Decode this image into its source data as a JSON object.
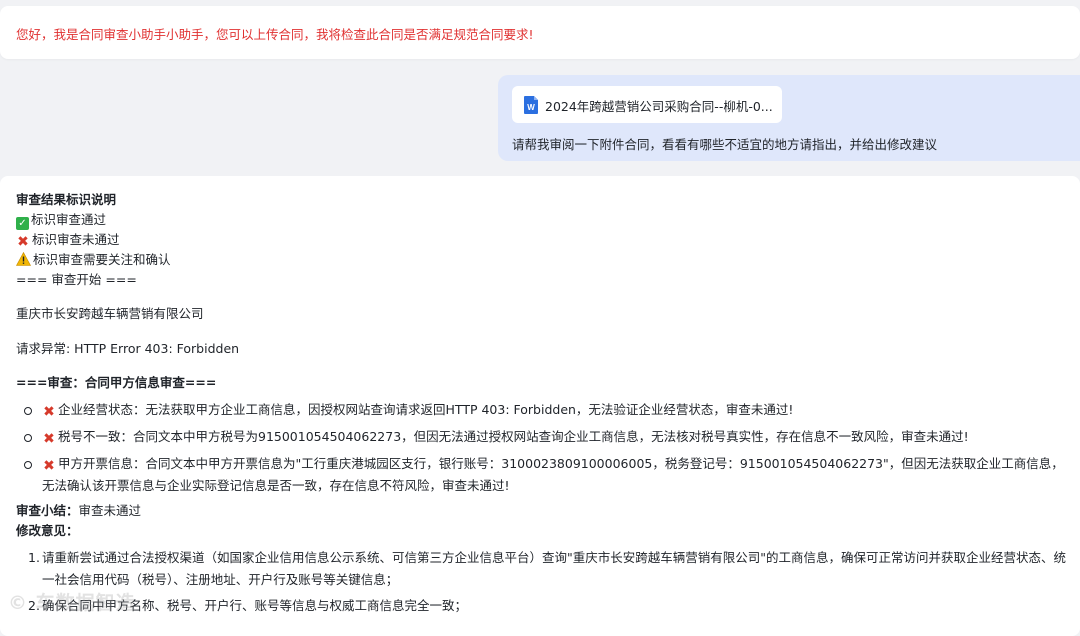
{
  "assistant_greeting": "您好，我是合同审查小助手小助手，您可以上传合同，我将检查此合同是否满足规范合同要求!",
  "user_message": {
    "file_name": "2024年跨越营销公司采购合同--柳机-0...",
    "file_icon": "word-doc-icon",
    "text": "请帮我审阅一下附件合同，看看有哪些不适宜的地方请指出，并给出修改建议"
  },
  "result": {
    "legend_title": "审查结果标识说明",
    "legend_pass": "标识审查通过",
    "legend_fail": "标识审查未通过",
    "legend_warn": "标识审查需要关注和确认",
    "start_marker": "=== 审查开始 ===",
    "company": "重庆市长安跨越车辆营销有限公司",
    "request_error": "请求异常: HTTP Error 403: Forbidden",
    "section_title": "===审查：合同甲方信息审查===",
    "items": [
      "企业经营状态：无法获取甲方企业工商信息，因授权网站查询请求返回HTTP 403: Forbidden，无法验证企业经营状态，审查未通过!",
      "税号不一致：合同文本中甲方税号为915001054504062273，但因无法通过授权网站查询企业工商信息，无法核对税号真实性，存在信息不一致风险，审查未通过!",
      "甲方开票信息：合同文本中甲方开票信息为\"工行重庆港城园区支行，银行账号：3100023809100006005，税务登记号：915001054504062273\"，但因无法获取企业工商信息，无法确认该开票信息与企业实际登记信息是否一致，存在信息不符风险，审查未通过!"
    ],
    "summary_label": "审查小结：",
    "summary_value": "审查未通过",
    "advice_label": "修改意见：",
    "advice": [
      "请重新尝试通过合法授权渠道（如国家企业信用信息公示系统、可信第三方企业信息平台）查询\"重庆市长安跨越车辆营销有限公司\"的工商信息，确保可正常访问并获取企业经营状态、统一社会信用代码（税号）、注册地址、开户行及账号等关键信息；",
      "确保合同中甲方名称、税号、开户行、账号等信息与权威工商信息完全一致；"
    ],
    "advice_numbers": [
      "1.",
      "2."
    ]
  },
  "watermark": "©  车数据智造",
  "colors": {
    "greeting": "#e03131",
    "user_bubble": "#dfe7fb",
    "fail": "#d63a2b",
    "pass": "#2fb04a",
    "warn": "#f2b705"
  }
}
